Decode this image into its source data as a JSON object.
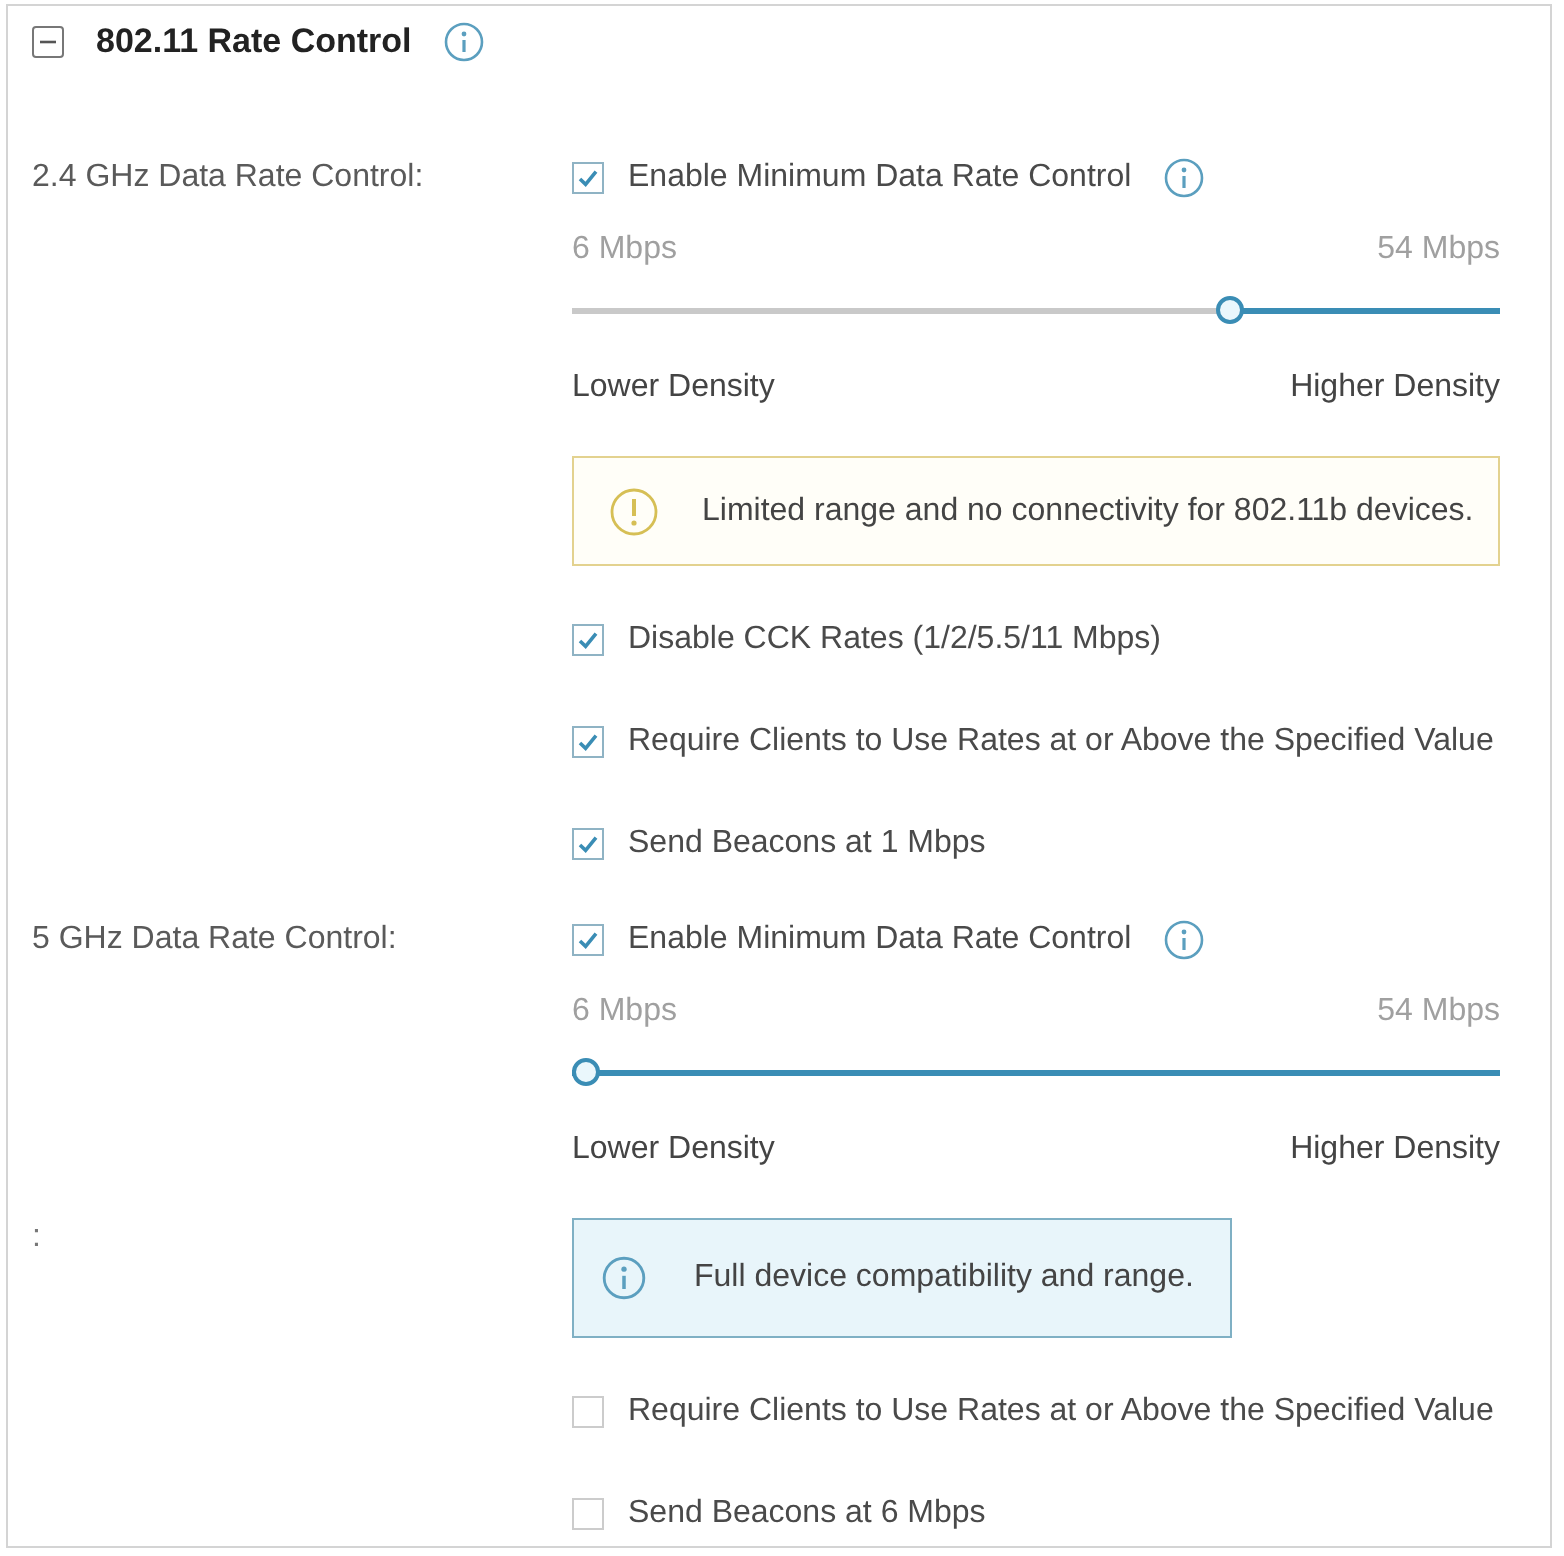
{
  "section": {
    "title": "802.11 Rate Control",
    "expanded": true
  },
  "groups": [
    {
      "label": "2.4 GHz Data Rate Control:",
      "enable": {
        "label": "Enable Minimum Data Rate Control",
        "checked": true
      },
      "slider": {
        "min_label": "6 Mbps",
        "max_label": "54 Mbps",
        "level": 0.29
      },
      "density": {
        "low_label": "Lower Density",
        "high_label": "Higher Density"
      },
      "notice": {
        "kind": "warning",
        "text": "Limited range and no connectivity for 802.11b devices."
      },
      "options": [
        {
          "label": "Disable CCK Rates (1/2/5.5/11 Mbps)",
          "checked": true
        },
        {
          "label": "Require Clients to Use Rates at or Above the Specified Value",
          "checked": true
        },
        {
          "label": "Send Beacons at 1 Mbps",
          "checked": true
        }
      ]
    },
    {
      "label": "5 GHz Data Rate Control:",
      "enable": {
        "label": "Enable Minimum Data Rate Control",
        "checked": true
      },
      "slider": {
        "min_label": "6 Mbps",
        "max_label": "54 Mbps",
        "level": 1
      },
      "density": {
        "low_label": "Lower Density",
        "high_label": "Higher Density"
      },
      "notice": {
        "kind": "info",
        "label": ":",
        "text": "Full device compatibility and range."
      },
      "options": [
        {
          "label": "Require Clients to Use Rates at or Above the Specified Value",
          "checked": false
        },
        {
          "label": "Send Beacons at 6 Mbps",
          "checked": false
        }
      ]
    }
  ]
}
